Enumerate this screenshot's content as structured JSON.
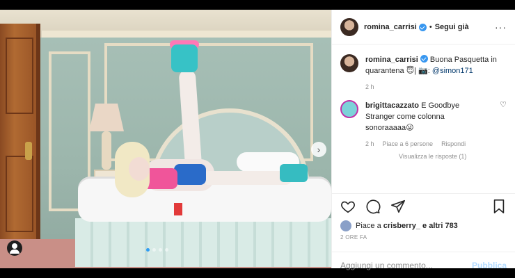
{
  "post": {
    "author": "romina_carrisi",
    "header_sep": "•",
    "follow_state": "Segui già",
    "more_icon": "more-options-icon"
  },
  "caption": {
    "username": "romina_carrisi",
    "text": "Buona Pasquetta in quarantena 😇| 📷: ",
    "mention": "@simon171",
    "time": "2 h"
  },
  "comment": {
    "username": "brigittacazzato",
    "text": "E Goodbye Stranger come colonna sonoraaaaa😜",
    "time": "2 h",
    "likes": "Piace a 6 persone",
    "reply": "Rispondi",
    "view_replies": "Visualizza le risposte (1)"
  },
  "likes": {
    "prefix": "Piace a",
    "user": "crisberry_",
    "suffix": "e altri 783"
  },
  "timestamp": "2 ORE FA",
  "add_comment": {
    "placeholder": "Aggiungi un commento...",
    "publish": "Pubblica"
  },
  "colors": {
    "link": "#00376b",
    "publish_disabled": "#b3dbff",
    "verified": "#3897f0"
  }
}
